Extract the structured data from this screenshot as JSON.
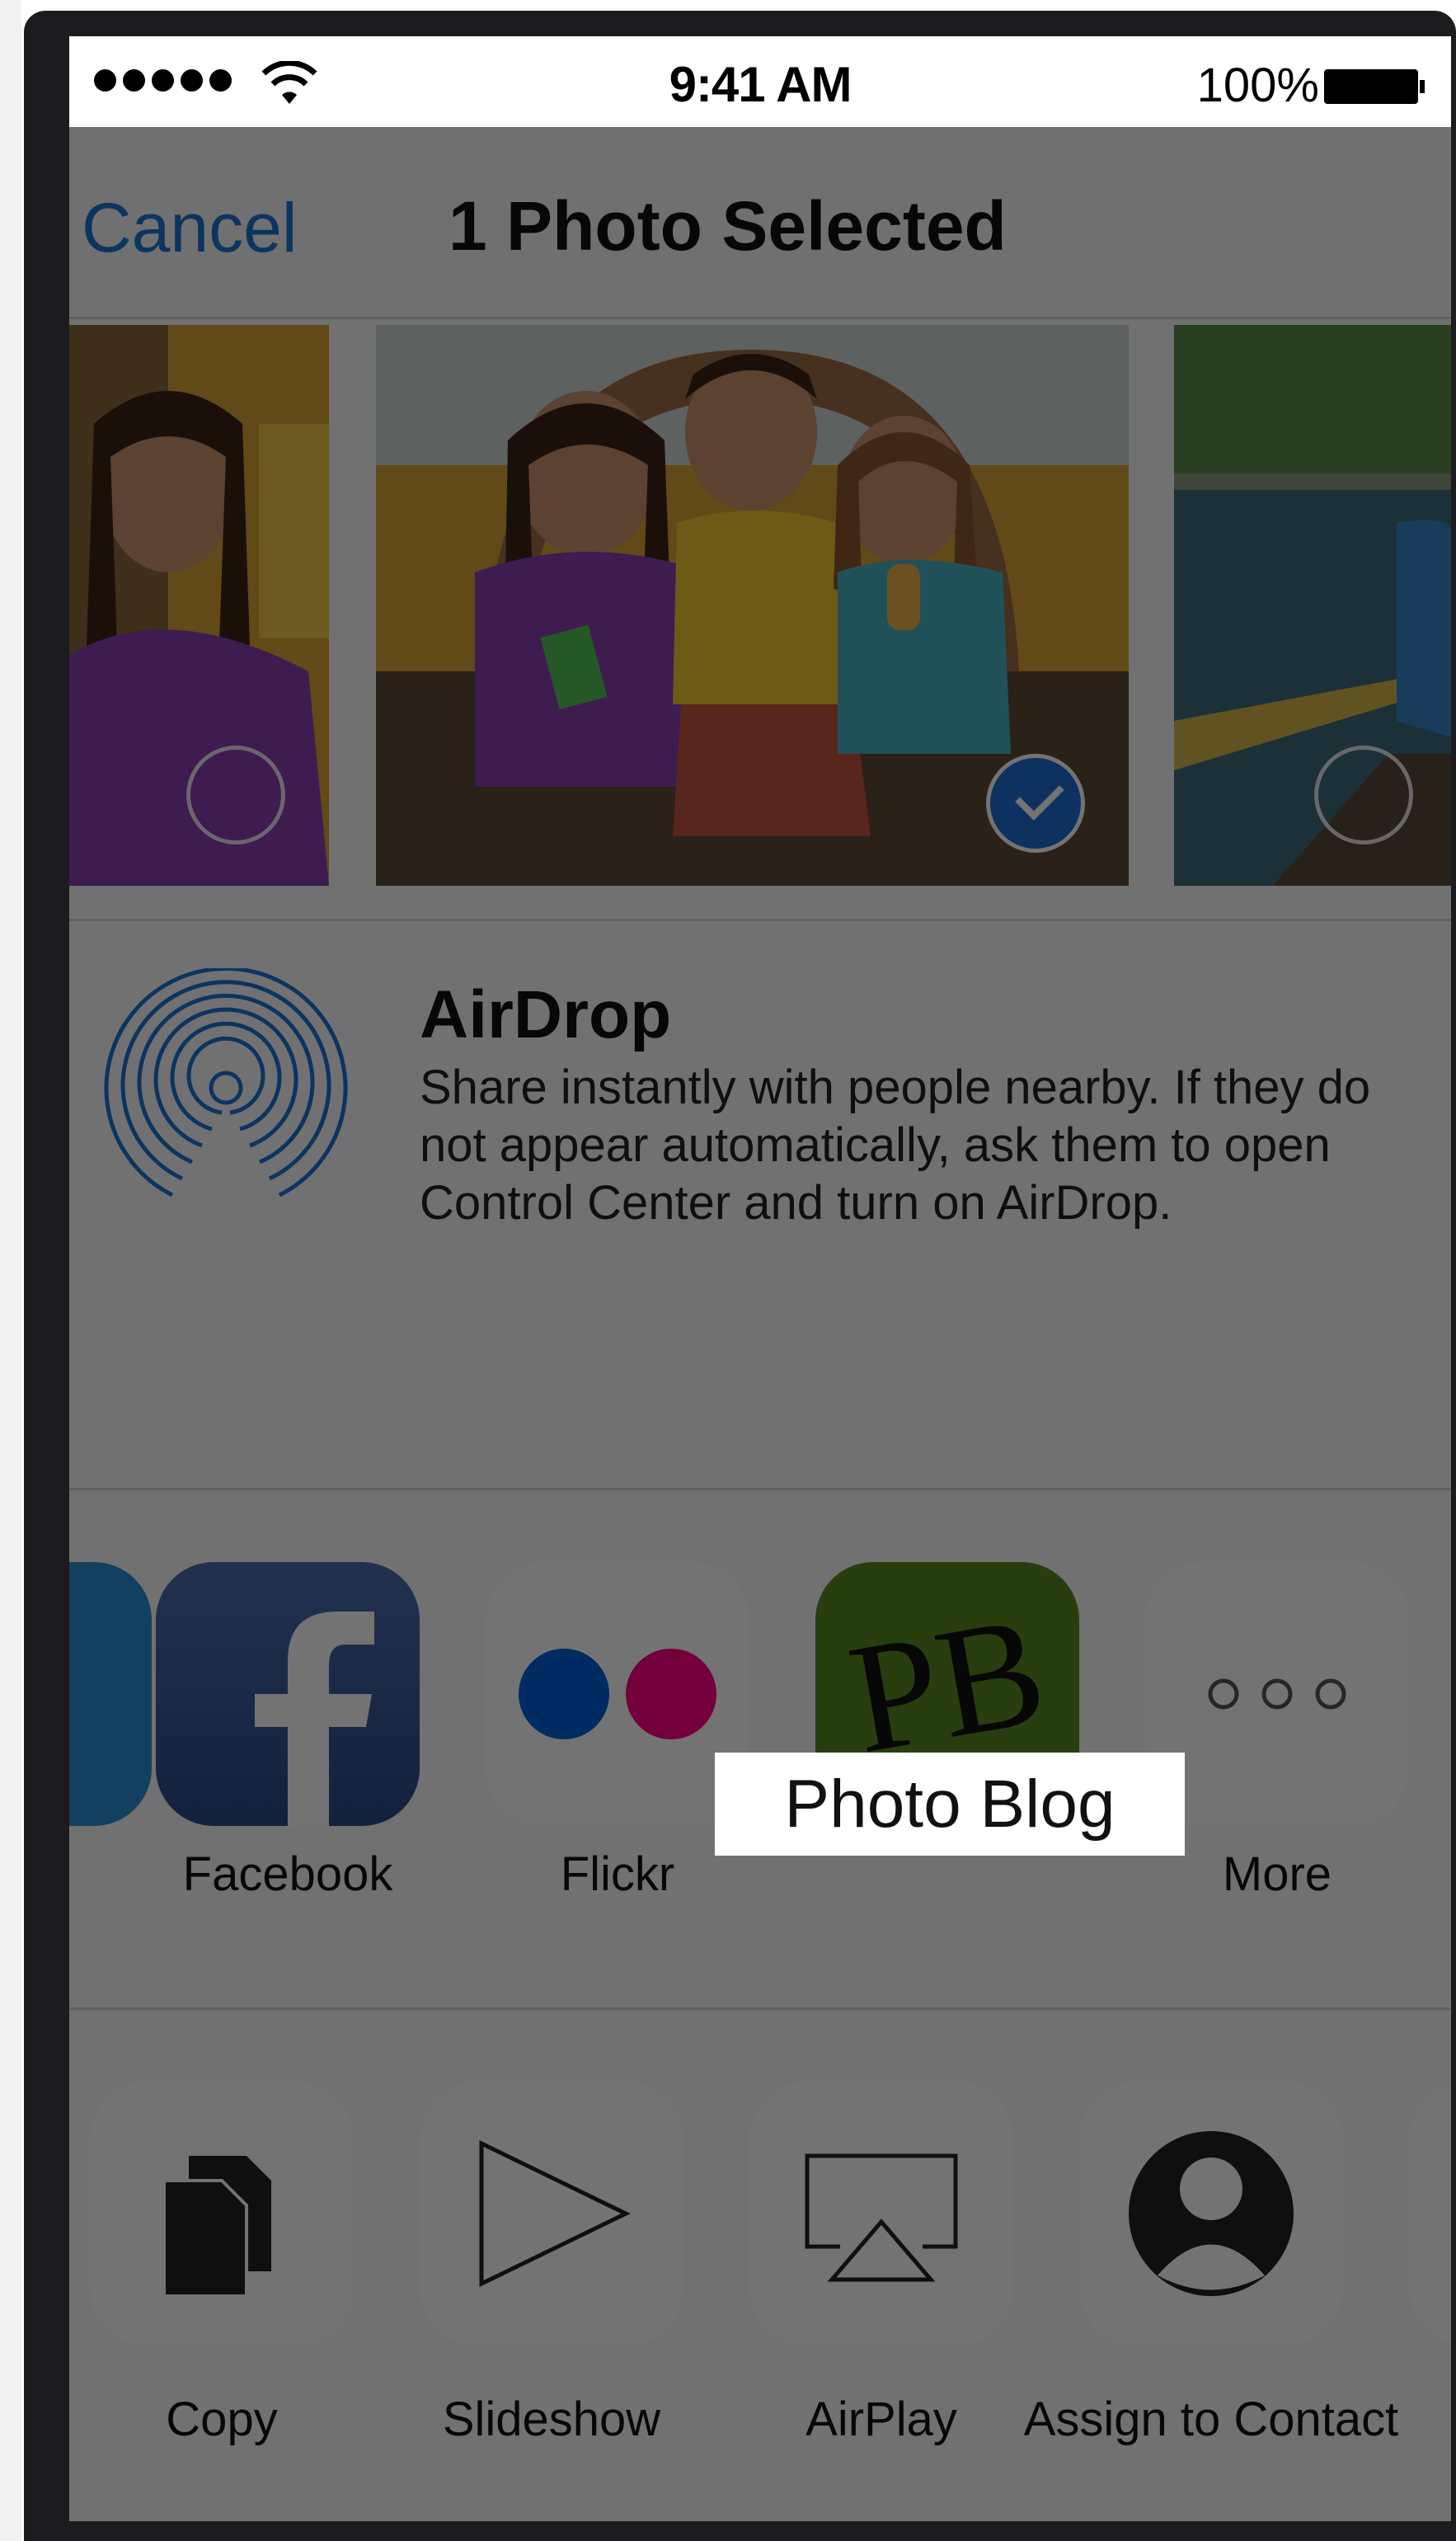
{
  "status_bar": {
    "time": "9:41 AM",
    "battery": "100%"
  },
  "nav": {
    "cancel": "Cancel",
    "title": "1 Photo Selected"
  },
  "airdrop": {
    "title": "AirDrop",
    "description": "Share instantly with people nearby. If they do not appear automatically, ask them to open Control Center and turn on AirDrop."
  },
  "apps": [
    {
      "label": "Facebook",
      "icon": "facebook-icon"
    },
    {
      "label": "Flickr",
      "icon": "flickr-icon"
    },
    {
      "label": "Photo Blog",
      "icon": "photo-blog-icon",
      "icon_text": "PB"
    },
    {
      "label": "More",
      "icon": "more-icon"
    }
  ],
  "actions": [
    {
      "label": "Copy",
      "icon": "copy-icon"
    },
    {
      "label": "Slideshow",
      "icon": "play-icon"
    },
    {
      "label": "AirPlay",
      "icon": "airplay-icon"
    },
    {
      "label": "Assign to Contact",
      "icon": "contact-icon"
    }
  ],
  "colors": {
    "accent": "#1a76d2",
    "facebook": "#3b5998",
    "flickr_blue": "#0063dc",
    "flickr_pink": "#ff0084",
    "photo_blog": "#5a8a22"
  }
}
